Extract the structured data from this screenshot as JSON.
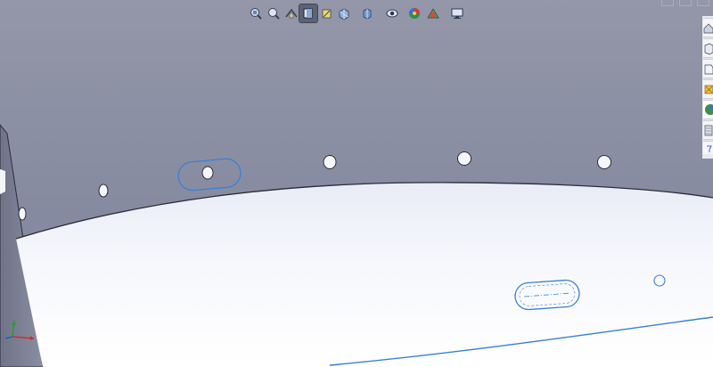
{
  "viewport": {
    "background_top": "#9397a8",
    "background_bottom": "#7f8399",
    "part_face_color": "#f2f4fa",
    "selection_color": "#3a7fd8",
    "edge_color": "#2a2d38"
  },
  "heads_up_toolbar": [
    {
      "name": "zoom-to-fit-icon",
      "active": false
    },
    {
      "name": "zoom-to-area-icon",
      "active": false
    },
    {
      "name": "previous-view-icon",
      "active": false
    },
    {
      "name": "section-view-icon",
      "active": true
    },
    {
      "name": "dynamic-annotation-icon",
      "active": false
    },
    {
      "name": "view-orientation-icon",
      "active": false
    },
    {
      "name": "display-style-icon",
      "active": false
    },
    {
      "name": "hide-show-items-icon",
      "active": false
    },
    {
      "name": "edit-appearance-icon",
      "active": false
    },
    {
      "name": "apply-scene-icon",
      "active": false
    },
    {
      "name": "view-settings-icon",
      "active": false
    }
  ],
  "task_pane_tabs": [
    {
      "name": "home-icon",
      "active": false
    },
    {
      "name": "design-library-icon",
      "active": false
    },
    {
      "name": "file-explorer-icon",
      "active": false
    },
    {
      "name": "view-palette-icon",
      "active": false
    },
    {
      "name": "appearances-icon",
      "active": true
    },
    {
      "name": "custom-properties-icon",
      "active": false
    },
    {
      "name": "pin-icon",
      "active": false
    }
  ],
  "triad": {
    "axes": [
      "x",
      "y",
      "z"
    ],
    "colors": {
      "x": "#d62828",
      "y": "#2e9b2e",
      "z": "#2f56d6"
    }
  }
}
